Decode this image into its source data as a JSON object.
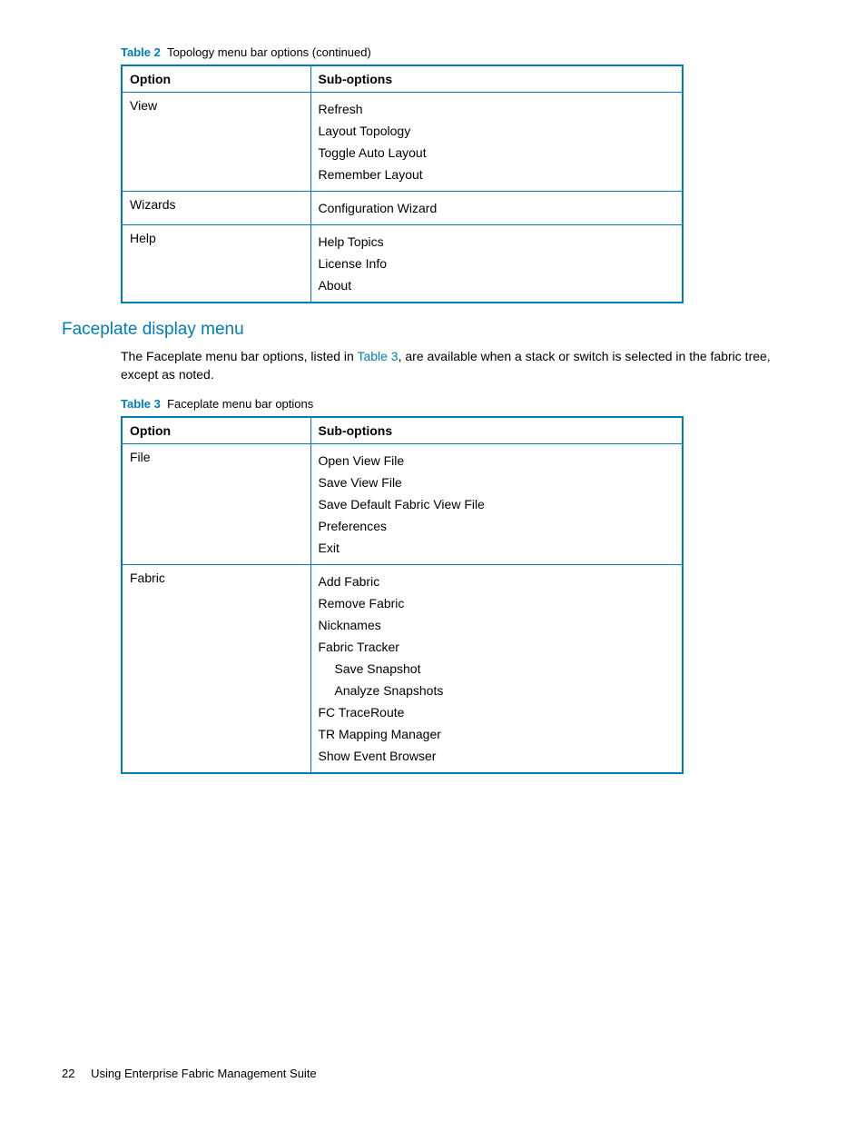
{
  "table2": {
    "label": "Table 2",
    "title": "Topology menu bar options  (continued)",
    "headers": {
      "option": "Option",
      "sub": "Sub-options"
    },
    "rows": [
      {
        "option": "View",
        "subs": [
          "Refresh",
          "Layout Topology",
          "Toggle Auto Layout",
          "Remember Layout"
        ]
      },
      {
        "option": "Wizards",
        "subs": [
          "Configuration Wizard"
        ]
      },
      {
        "option": "Help",
        "subs": [
          "Help Topics",
          "License Info",
          "About"
        ]
      }
    ]
  },
  "section": {
    "heading": "Faceplate display menu",
    "body_pre": "The Faceplate menu bar options, listed in ",
    "body_link": "Table 3",
    "body_post": ", are available when a stack or switch is selected in the fabric tree, except as noted."
  },
  "table3": {
    "label": "Table 3",
    "title": "Faceplate menu bar options",
    "headers": {
      "option": "Option",
      "sub": "Sub-options"
    },
    "rows": [
      {
        "option": "File",
        "subs": [
          {
            "text": "Open View File"
          },
          {
            "text": "Save View File"
          },
          {
            "text": "Save Default Fabric View File"
          },
          {
            "text": "Preferences"
          },
          {
            "text": "Exit"
          }
        ]
      },
      {
        "option": "Fabric",
        "subs": [
          {
            "text": "Add Fabric"
          },
          {
            "text": "Remove Fabric"
          },
          {
            "text": "Nicknames"
          },
          {
            "text": "Fabric Tracker"
          },
          {
            "text": "Save Snapshot",
            "indent": true
          },
          {
            "text": "Analyze Snapshots",
            "indent": true
          },
          {
            "text": "FC TraceRoute"
          },
          {
            "text": "TR Mapping Manager"
          },
          {
            "text": "Show Event Browser"
          }
        ]
      }
    ]
  },
  "footer": {
    "page": "22",
    "title": "Using Enterprise Fabric Management Suite"
  }
}
